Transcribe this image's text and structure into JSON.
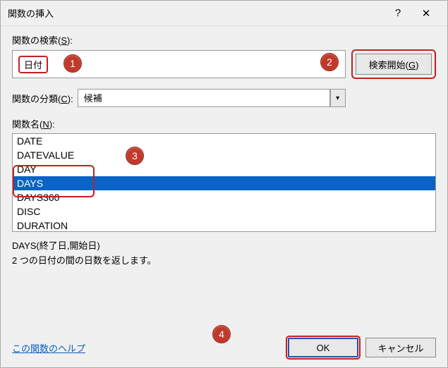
{
  "titlebar": {
    "title": "関数の挿入"
  },
  "search": {
    "label_prefix": "関数の検索(",
    "label_accel": "S",
    "label_suffix": "):",
    "value": "日付",
    "button_prefix": "検索開始(",
    "button_accel": "G",
    "button_suffix": ")"
  },
  "category": {
    "label_prefix": "関数の分類(",
    "label_accel": "C",
    "label_suffix": "):",
    "value": "候補"
  },
  "functions": {
    "label_prefix": "関数名(",
    "label_accel": "N",
    "label_suffix": "):",
    "items": [
      "DATE",
      "DATEVALUE",
      "DAY",
      "DAYS",
      "DAYS360",
      "DISC",
      "DURATION"
    ],
    "selected": "DAYS"
  },
  "description": {
    "syntax": "DAYS(終了日,開始日)",
    "text": "2 つの日付の間の日数を返します。"
  },
  "footer": {
    "help": "この関数のヘルプ",
    "ok": "OK",
    "cancel": "キャンセル"
  },
  "badges": {
    "b1": "1",
    "b2": "2",
    "b3": "3",
    "b4": "4"
  }
}
